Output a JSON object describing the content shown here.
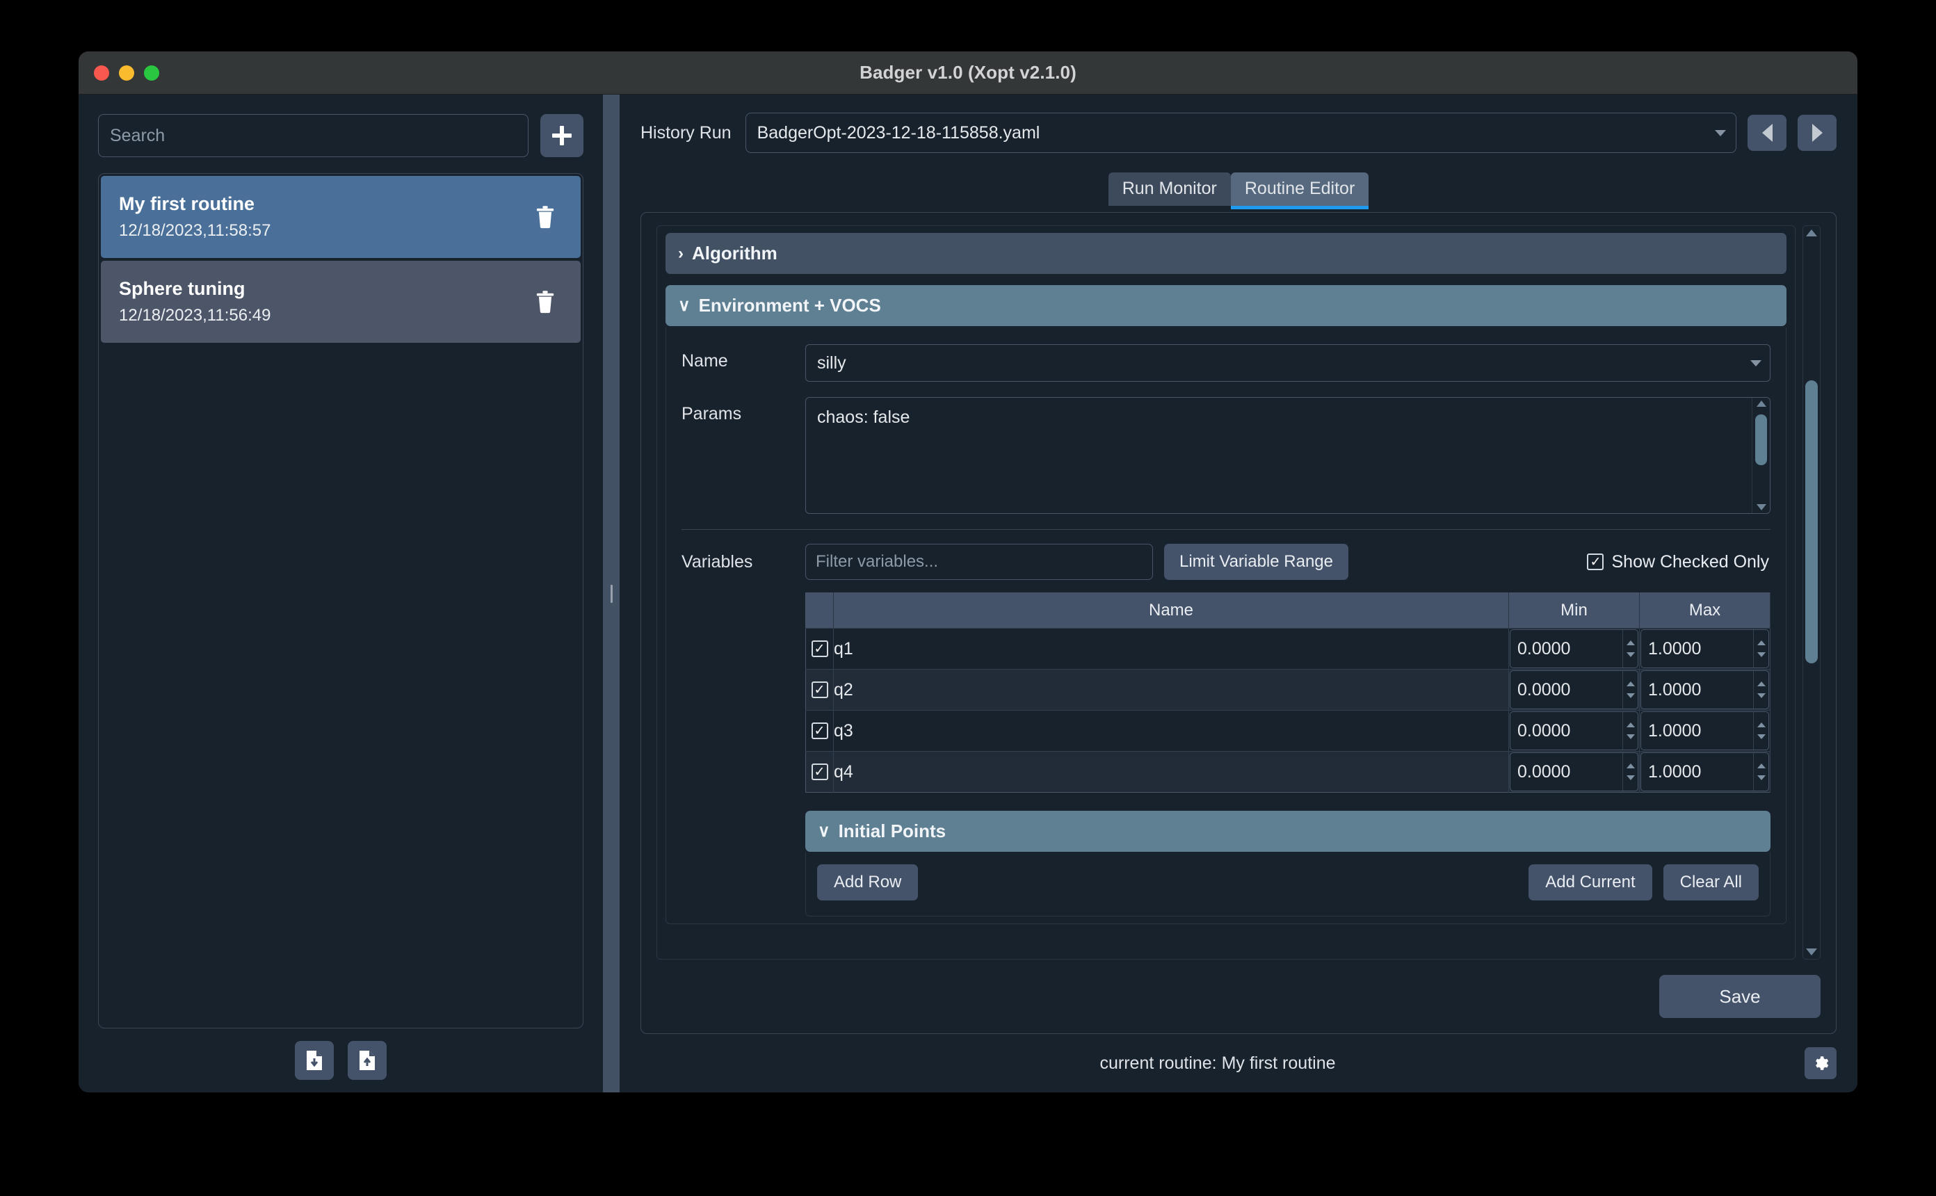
{
  "window": {
    "title": "Badger v1.0 (Xopt v2.1.0)",
    "traffic_lights": [
      "close-red",
      "minimize-yellow",
      "maximize-green"
    ]
  },
  "sidebar": {
    "search": {
      "placeholder": "Search",
      "value": ""
    },
    "add_button_icon": "plus-icon",
    "routines": [
      {
        "name": "My first routine",
        "timestamp": "12/18/2023,11:58:57",
        "selected": true,
        "delete_icon": "trash-icon"
      },
      {
        "name": "Sphere tuning",
        "timestamp": "12/18/2023,11:56:49",
        "selected": false,
        "delete_icon": "trash-icon"
      }
    ],
    "footer": {
      "import_icon": "file-download-icon",
      "export_icon": "file-upload-icon"
    }
  },
  "main": {
    "history": {
      "label": "History Run",
      "value": "BadgerOpt-2023-12-18-115858.yaml",
      "prev_icon": "triangle-left-icon",
      "next_icon": "triangle-right-icon"
    },
    "tabs": [
      {
        "label": "Run Monitor",
        "active": false
      },
      {
        "label": "Routine Editor",
        "active": true
      }
    ],
    "sections": {
      "algorithm": {
        "label": "Algorithm",
        "expanded": false,
        "chevron": "›"
      },
      "environment": {
        "label": "Environment + VOCS",
        "expanded": true,
        "chevron": "∨"
      },
      "initial_points": {
        "label": "Initial Points",
        "expanded": true,
        "chevron": "∨"
      }
    },
    "environment": {
      "name_label": "Name",
      "name_value": "silly",
      "params_label": "Params",
      "params_value": "chaos: false"
    },
    "variables": {
      "label": "Variables",
      "filter_placeholder": "Filter variables...",
      "filter_value": "",
      "limit_range_button": "Limit Variable Range",
      "show_checked_only_label": "Show Checked Only",
      "show_checked_only": true,
      "columns": [
        "",
        "Name",
        "Min",
        "Max"
      ],
      "rows": [
        {
          "checked": true,
          "name": "q1",
          "min": "0.0000",
          "max": "1.0000"
        },
        {
          "checked": true,
          "name": "q2",
          "min": "0.0000",
          "max": "1.0000"
        },
        {
          "checked": true,
          "name": "q3",
          "min": "0.0000",
          "max": "1.0000"
        },
        {
          "checked": true,
          "name": "q4",
          "min": "0.0000",
          "max": "1.0000"
        }
      ]
    },
    "initial_points_actions": {
      "add_row": "Add Row",
      "add_current": "Add Current",
      "clear_all": "Clear All"
    },
    "save_button": "Save"
  },
  "statusbar": {
    "text": "current routine: My first routine",
    "settings_icon": "gear-icon"
  },
  "colors": {
    "window_bg": "#18222d",
    "titlebar_bg": "#343737",
    "accent_blue": "#1e9bef",
    "selected_routine": "#4a7099",
    "section_expanded": "#5f7f93",
    "section_collapsed": "#425264",
    "button_bg": "#44536a"
  }
}
